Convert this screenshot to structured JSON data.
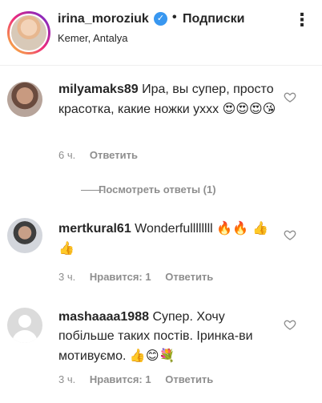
{
  "header": {
    "username": "irina_moroziuk",
    "verified_mark": "✓",
    "separator": "•",
    "follow_label": "Подписки",
    "location": "Kemer, Antalya",
    "more_icon": "⋮"
  },
  "comments": [
    {
      "username": "milyamaks89",
      "text": "Ира, вы супер, просто красотка, какие ножки ухxx",
      "emoji": "😍😍😍😘",
      "time": "6 ч.",
      "likes": "",
      "reply_label": "Ответить",
      "view_replies": "Посмотреть ответы (1)"
    },
    {
      "username": "mertkural61",
      "text": "Wonderfullllllll",
      "emoji": "🔥🔥 👍👍",
      "time": "3 ч.",
      "likes": "Нравится: 1",
      "reply_label": "Ответить"
    },
    {
      "username": "mashaaaa1988",
      "text": "Супер. Хочу побільше таких постів. Іринка-ви мотивуємо.",
      "emoji": "👍😊💐",
      "time": "3 ч.",
      "likes": "Нравится: 1",
      "reply_label": "Ответить"
    }
  ],
  "colors": {
    "text": "#262626",
    "secondary": "#8e8e8e",
    "verified": "#3897f0",
    "divider": "#efefef"
  }
}
